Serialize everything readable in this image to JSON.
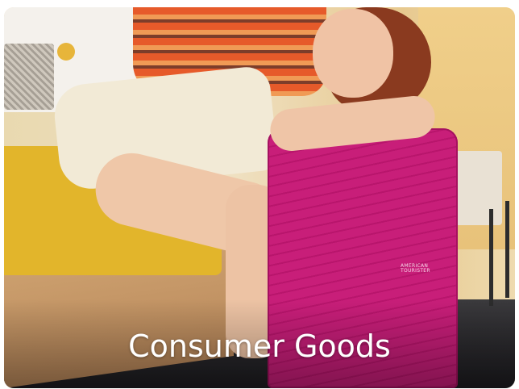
{
  "card": {
    "title": "Consumer Goods",
    "image": {
      "suitcase_color": "#c81e79",
      "blanket_color": "#e2b52b",
      "brand_text": [
        "AMERICAN",
        "TOURISTER"
      ]
    }
  }
}
